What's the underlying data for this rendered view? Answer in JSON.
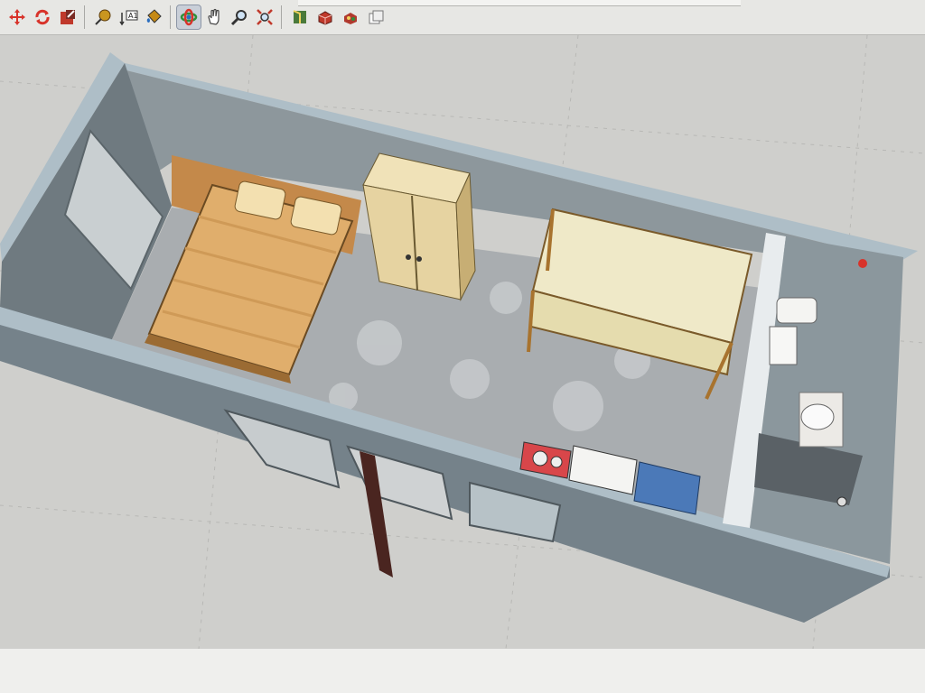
{
  "toolbar": {
    "tools": [
      {
        "name": "move-icon",
        "color": "#d8332a"
      },
      {
        "name": "rotate-icon",
        "color": "#d8332a"
      },
      {
        "name": "scale-icon",
        "color": "#c0392b"
      },
      {
        "name": "tape-measure-icon",
        "color": "#6b4b16"
      },
      {
        "name": "text-tool-icon",
        "label": "A1",
        "color": "#333333"
      },
      {
        "name": "paint-bucket-icon",
        "color": "#c58a16"
      },
      {
        "name": "orbit-icon",
        "color": "#2f8f3a",
        "active": true
      },
      {
        "name": "pan-icon",
        "color": "#555555"
      },
      {
        "name": "zoom-icon",
        "color": "#3b3b3b"
      },
      {
        "name": "zoom-extents-icon",
        "color": "#c0392b"
      },
      {
        "name": "section-plane-icon",
        "color": "#4a7a3a"
      },
      {
        "name": "components-icon",
        "color": "#c0392b"
      },
      {
        "name": "materials-icon",
        "color": "#b03a2e"
      },
      {
        "name": "export-icon",
        "color": "#777777"
      }
    ]
  },
  "viewport": {
    "model": "room-floor-plan-3d",
    "furniture": [
      "double-bed",
      "wardrobe",
      "bunk-bed",
      "stove",
      "counter",
      "sink-cabinet",
      "toilet",
      "washbasin",
      "shower"
    ],
    "colors": {
      "walls": "#7f8b91",
      "wall_top": "#aebec7",
      "floor": "#a9adb0",
      "bed_wood": "#e0ae6c",
      "wardrobe": "#e6d3a1",
      "bunk": "#efe9c8",
      "stove": "#d8464a",
      "cabinet": "#4b79b8"
    }
  }
}
